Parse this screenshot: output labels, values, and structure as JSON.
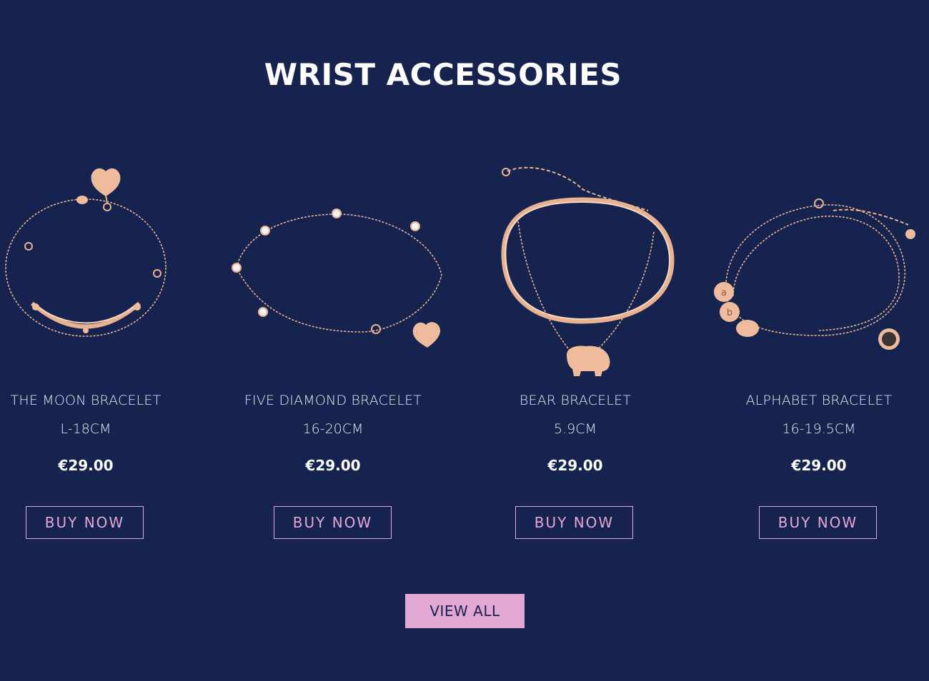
{
  "section": {
    "title": "WRIST ACCESSORIES"
  },
  "products": [
    {
      "name": "THE MOON BRACELET",
      "size": "L-18CM",
      "price": "€29.00",
      "cta": "BUY NOW"
    },
    {
      "name": "FIVE DIAMOND BRACELET",
      "size": "16-20CM",
      "price": "€29.00",
      "cta": "BUY NOW"
    },
    {
      "name": "BEAR BRACELET",
      "size": "5.9CM",
      "price": "€29.00",
      "cta": "BUY NOW"
    },
    {
      "name": "ALPHABET BRACELET",
      "size": "16-19.5CM",
      "price": "€29.00",
      "cta": "BUY NOW"
    }
  ],
  "view_all": {
    "label": "VIEW ALL"
  },
  "colors": {
    "background": "#17234f",
    "accent": "#e2a7d3",
    "gold": "#e8b18f"
  }
}
